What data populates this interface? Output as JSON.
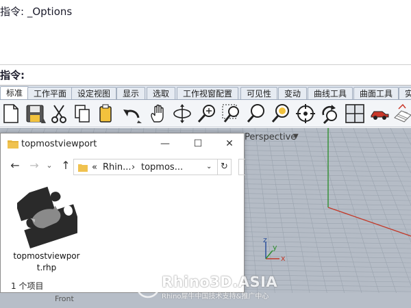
{
  "command": {
    "history_line": "指令: _Options",
    "prompt_label": "指令:"
  },
  "tabs": [
    {
      "label": "标准",
      "active": true
    },
    {
      "label": "工作平面"
    },
    {
      "label": "设定视图"
    },
    {
      "label": "显示"
    },
    {
      "label": "选取"
    },
    {
      "label": "工作视窗配置"
    },
    {
      "label": "可见性"
    },
    {
      "label": "变动"
    },
    {
      "label": "曲线工具"
    },
    {
      "label": "曲面工具"
    },
    {
      "label": "实"
    }
  ],
  "toolbar_icons": [
    "new-file-icon",
    "save-icon",
    "cut-icon",
    "copy-icon",
    "paste-icon",
    "undo-icon",
    "pan-hand-icon",
    "rotate-view-icon",
    "zoom-icon",
    "zoom-window-icon",
    "zoom-extents-icon",
    "zoom-selected-icon",
    "target-icon",
    "rotate-camera-icon",
    "four-viewports-icon",
    "car-render-icon",
    "grid-display-icon"
  ],
  "viewport": {
    "title": "Perspective",
    "axis_x": "x",
    "axis_y": "y",
    "axis_z": "z",
    "bottom_tab": "Front"
  },
  "explorer": {
    "title": "topmostviewport",
    "address_segments": [
      "«",
      "Rhin...",
      "›",
      "topmos..."
    ],
    "file_name": "topmostviewport.rhp",
    "status": "1 个项目",
    "colors": {
      "folder": "#f0c24f",
      "puzzle": "#2a2a2a"
    }
  },
  "watermark": {
    "main": "Rhino3D.ASIA",
    "sub": "Rhino犀牛中国技术支持&推广中心"
  }
}
